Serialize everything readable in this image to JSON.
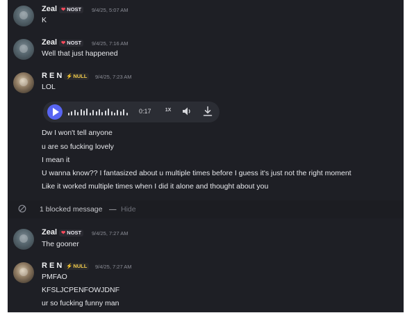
{
  "messages": [
    {
      "author": "Zeal",
      "badge": "NOST",
      "time": "9/4/25, 5:07 AM",
      "text": "K"
    },
    {
      "author": "Zeal",
      "badge": "NOST",
      "time": "9/4/25, 7:16 AM",
      "text": "Well that just happened"
    },
    {
      "author": "R E N",
      "badge": "NULL",
      "time": "9/4/25, 7:23 AM",
      "lines": [
        "LOL",
        "Dw I won't tell anyone",
        "u are so fucking lovely",
        "I mean it",
        "U wanna know?? I fantasized about u multiple times before I guess it's just not the right moment",
        "Like it worked multiple times when I did it alone and thought about you"
      ]
    },
    {
      "author": "Zeal",
      "badge": "NOST",
      "time": "9/4/25, 7:27 AM",
      "text": "The gooner"
    },
    {
      "author": "R E N",
      "badge": "NULL",
      "time": "9/4/25, 7:27 AM",
      "lines": [
        "PMFAO",
        "KFSLJCPENFOWJDNF",
        "ur so fucking funny man"
      ]
    }
  ],
  "audio": {
    "duration": "0:17",
    "speed": "1X",
    "play_icon": "play-icon",
    "volume_icon": "volume-icon",
    "download_icon": "download-icon"
  },
  "blocked": {
    "label": "1 blocked message",
    "separator": "—",
    "hide": "Hide",
    "icon": "blocked-icon"
  },
  "colors": {
    "background": "#1e1f25",
    "accent": "#5865f2",
    "nost_badge": "#ff4b5c",
    "null_badge": "#efc94c"
  }
}
